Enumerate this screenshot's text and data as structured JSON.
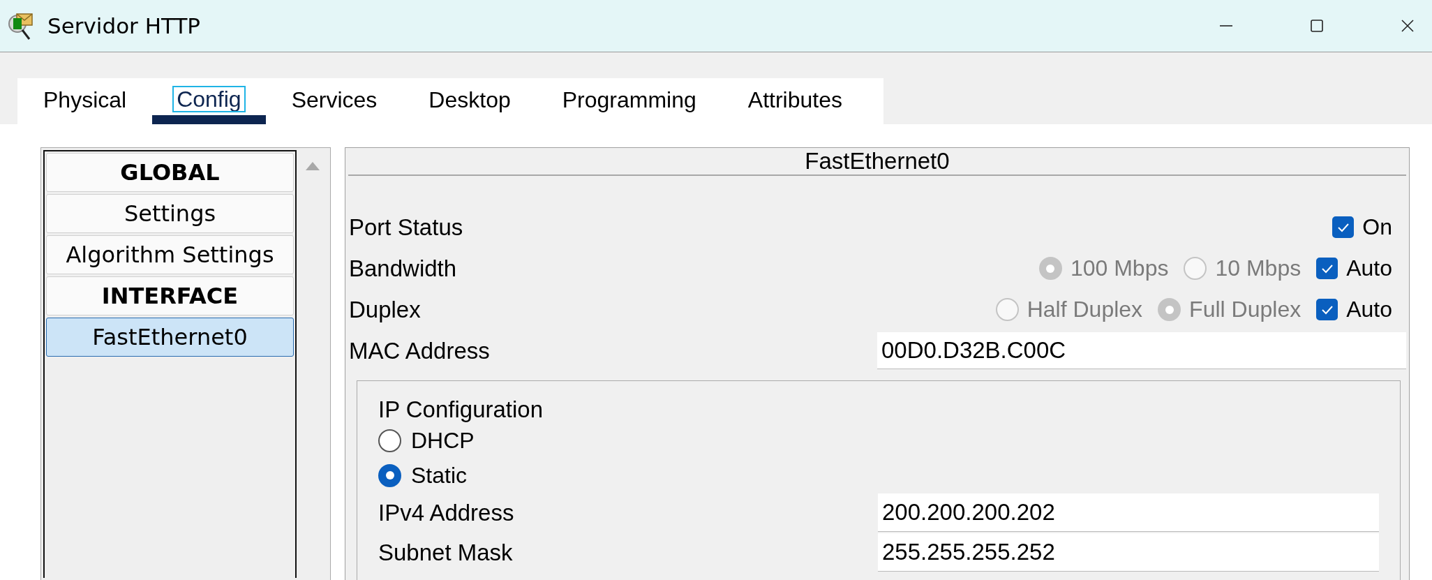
{
  "window": {
    "title": "Servidor HTTP"
  },
  "tabs": [
    {
      "label": "Physical",
      "selected": false
    },
    {
      "label": "Config",
      "selected": true
    },
    {
      "label": "Services",
      "selected": false
    },
    {
      "label": "Desktop",
      "selected": false
    },
    {
      "label": "Programming",
      "selected": false
    },
    {
      "label": "Attributes",
      "selected": false
    }
  ],
  "sidebar": {
    "items": [
      {
        "label": "GLOBAL",
        "kind": "header",
        "selected": false
      },
      {
        "label": "Settings",
        "kind": "item",
        "selected": false
      },
      {
        "label": "Algorithm Settings",
        "kind": "item",
        "selected": false
      },
      {
        "label": "INTERFACE",
        "kind": "header",
        "selected": false
      },
      {
        "label": "FastEthernet0",
        "kind": "item",
        "selected": true
      }
    ]
  },
  "panel": {
    "title": "FastEthernet0",
    "port_status": {
      "label": "Port Status",
      "toggle": {
        "label": "On",
        "checked": true
      }
    },
    "bandwidth": {
      "label": "Bandwidth",
      "options": [
        {
          "label": "100 Mbps",
          "selected": true,
          "disabled": true
        },
        {
          "label": "10 Mbps",
          "selected": false,
          "disabled": true
        }
      ],
      "auto": {
        "label": "Auto",
        "checked": true
      }
    },
    "duplex": {
      "label": "Duplex",
      "options": [
        {
          "label": "Half Duplex",
          "selected": false,
          "disabled": true
        },
        {
          "label": "Full Duplex",
          "selected": true,
          "disabled": true
        }
      ],
      "auto": {
        "label": "Auto",
        "checked": true
      }
    },
    "mac_address": {
      "label": "MAC Address",
      "value": "00D0.D32B.C00C"
    },
    "ip_configuration": {
      "title": "IP Configuration",
      "modes": [
        {
          "label": "DHCP",
          "selected": false
        },
        {
          "label": "Static",
          "selected": true
        }
      ],
      "fields": [
        {
          "label": "IPv4 Address",
          "value": "200.200.200.202"
        },
        {
          "label": "Subnet Mask",
          "value": "255.255.255.252"
        }
      ]
    }
  }
}
